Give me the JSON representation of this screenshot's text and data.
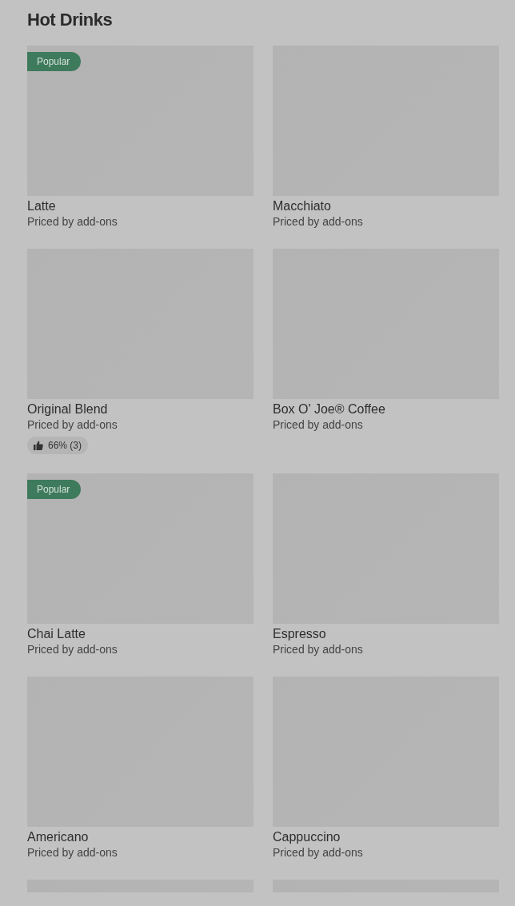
{
  "section": {
    "title": "Hot Drinks"
  },
  "items": [
    {
      "kind": "card",
      "name": "Latte",
      "price": "Priced by add-ons",
      "badge": "Popular"
    },
    {
      "kind": "card",
      "name": "Macchiato",
      "price": "Priced by add-ons"
    },
    {
      "kind": "card",
      "name": "Original Blend",
      "price": "Priced by add-ons",
      "rating": "66% (3)"
    },
    {
      "kind": "card",
      "name": "Box O' Joe® Coffee",
      "price": "Priced by add-ons"
    },
    {
      "kind": "card",
      "name": "Chai Latte",
      "price": "Priced by add-ons",
      "badge": "Popular"
    },
    {
      "kind": "card",
      "name": "Espresso",
      "price": "Priced by add-ons"
    },
    {
      "kind": "card",
      "name": "Americano",
      "price": "Priced by add-ons"
    },
    {
      "kind": "card",
      "name": "Cappuccino",
      "price": "Priced by add-ons"
    },
    {
      "kind": "cut"
    },
    {
      "kind": "cut"
    }
  ]
}
